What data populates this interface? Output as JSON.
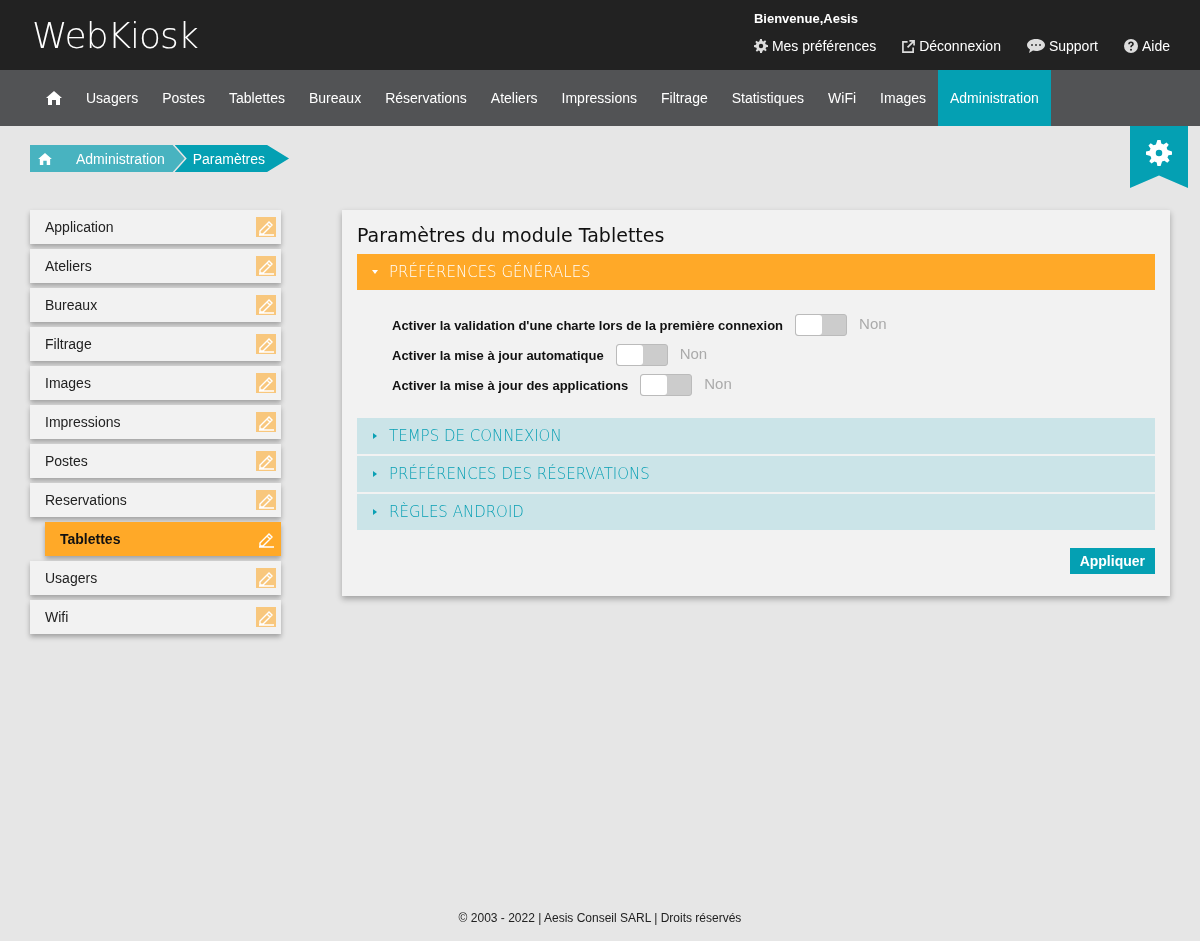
{
  "header": {
    "logo": "WebKiosk",
    "welcome": "Bienvenue,Aesis",
    "links": [
      {
        "kind": "gear",
        "label": "Mes préférences"
      },
      {
        "kind": "external",
        "label": "Déconnexion"
      },
      {
        "kind": "chat",
        "label": "Support"
      },
      {
        "kind": "help",
        "label": "Aide"
      }
    ]
  },
  "nav": {
    "items": [
      {
        "label": "Usagers",
        "selected": false
      },
      {
        "label": "Postes",
        "selected": false
      },
      {
        "label": "Tablettes",
        "selected": false
      },
      {
        "label": "Bureaux",
        "selected": false
      },
      {
        "label": "Réservations",
        "selected": false
      },
      {
        "label": "Ateliers",
        "selected": false
      },
      {
        "label": "Impressions",
        "selected": false
      },
      {
        "label": "Filtrage",
        "selected": false
      },
      {
        "label": "Statistiques",
        "selected": false
      },
      {
        "label": "WiFi",
        "selected": false
      },
      {
        "label": "Images",
        "selected": false
      },
      {
        "label": "Administration",
        "selected": true
      }
    ]
  },
  "breadcrumb": [
    "Administration",
    "Paramètres"
  ],
  "sidebar": {
    "items": [
      {
        "label": "Application",
        "selected": false
      },
      {
        "label": "Ateliers",
        "selected": false
      },
      {
        "label": "Bureaux",
        "selected": false
      },
      {
        "label": "Filtrage",
        "selected": false
      },
      {
        "label": "Images",
        "selected": false
      },
      {
        "label": "Impressions",
        "selected": false
      },
      {
        "label": "Postes",
        "selected": false
      },
      {
        "label": "Reservations",
        "selected": false,
        "children": [
          {
            "label": "Tablettes",
            "selected": true
          }
        ]
      },
      {
        "label": "Usagers",
        "selected": false
      },
      {
        "label": "Wifi",
        "selected": false
      }
    ]
  },
  "panel": {
    "title": "Paramètres du module Tablettes",
    "sections": [
      {
        "title": "PRÉFÉRENCES GÉNÉRALES",
        "expanded": true,
        "settings": [
          {
            "label": "Activer la validation d'une charte lors de la première connexion",
            "on": false,
            "state_text": "Non"
          },
          {
            "label": "Activer la mise à jour automatique",
            "on": false,
            "state_text": "Non"
          },
          {
            "label": "Activer la mise à jour des applications",
            "on": false,
            "state_text": "Non"
          }
        ]
      },
      {
        "title": "TEMPS DE CONNEXION",
        "expanded": false
      },
      {
        "title": "PRÉFÉRENCES DES RÉSERVATIONS",
        "expanded": false
      },
      {
        "title": "RÈGLES ANDROID",
        "expanded": false
      }
    ],
    "apply_button": "Appliquer"
  },
  "footer": "© 2003 - 2022 | Aesis Conseil SARL | Droits réservés"
}
